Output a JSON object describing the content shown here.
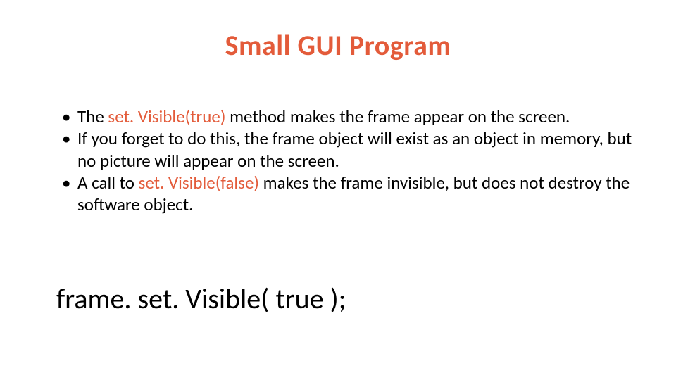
{
  "title": "Small GUI Program",
  "bullets": {
    "b1": {
      "pre": "The ",
      "hl": "set. Visible(true)",
      "post": " method makes the frame appear on the screen."
    },
    "b2": "If you forget to do this, the frame object will exist as an object in memory, but no picture will appear on the screen.",
    "b3": {
      "pre": "A call to ",
      "hl": "set. Visible(false)",
      "post": " makes the frame invisible, but does not destroy the software object."
    }
  },
  "code_line": "frame. set. Visible( true );"
}
